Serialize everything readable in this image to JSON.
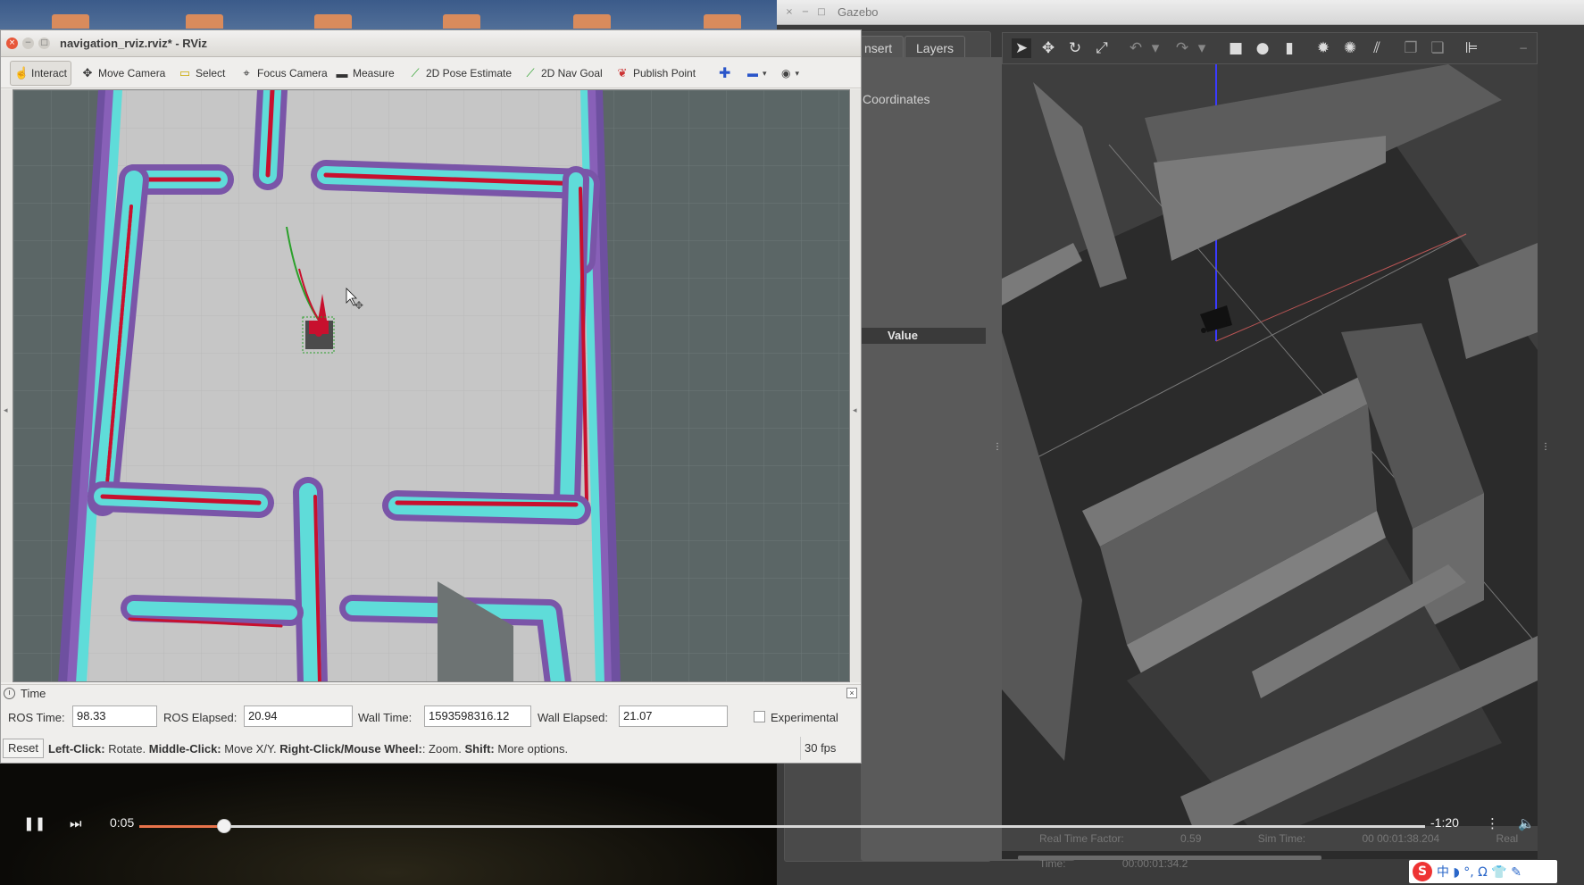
{
  "gazebo": {
    "title": "Gazebo",
    "tabs": [
      "nsert",
      "Layers"
    ],
    "coordinates_label": "Coordinates",
    "value_header": "Value",
    "status": {
      "real_time_factor_label": "Real Time Factor:",
      "real_time_factor": "0.59",
      "sim_time_label": "Sim Time:",
      "sim_time": "00 00:01:38.204",
      "real_time_label": "Real Time:",
      "real_time": "00:00:01:34.2"
    }
  },
  "rviz": {
    "title": "navigation_rviz.rviz* - RViz",
    "tools": [
      {
        "label": "Interact",
        "icon": "interact-icon",
        "active": true
      },
      {
        "label": "Move Camera",
        "icon": "move-camera-icon"
      },
      {
        "label": "Select",
        "icon": "select-icon"
      },
      {
        "label": "Focus Camera",
        "icon": "focus-camera-icon"
      },
      {
        "label": "Measure",
        "icon": "measure-icon"
      },
      {
        "label": "2D Pose Estimate",
        "icon": "pose-estimate-icon"
      },
      {
        "label": "2D Nav Goal",
        "icon": "nav-goal-icon"
      },
      {
        "label": "Publish Point",
        "icon": "publish-point-icon"
      }
    ],
    "time_panel": {
      "title": "Time",
      "ros_time_label": "ROS Time:",
      "ros_time": "98.33",
      "ros_elapsed_label": "ROS Elapsed:",
      "ros_elapsed": "20.94",
      "wall_time_label": "Wall Time:",
      "wall_time": "1593598316.12",
      "wall_elapsed_label": "Wall Elapsed:",
      "wall_elapsed": "21.07",
      "experimental_label": "Experimental"
    },
    "status": {
      "reset_label": "Reset",
      "help_left_click": "Left-Click:",
      "help_left_click_text": "Rotate.",
      "help_middle_click": "Middle-Click:",
      "help_middle_click_text": "Move X/Y.",
      "help_right_click": "Right-Click/Mouse Wheel:",
      "help_right_click_text": ": Zoom.",
      "help_shift": "Shift:",
      "help_shift_text": "More options.",
      "fps": "30 fps"
    }
  },
  "player": {
    "elapsed": "0:05",
    "remaining": "-1:20",
    "progress_fraction": 0.066
  },
  "ime": {
    "logo": "S",
    "items": "中 ◗ °, Ω 👕 ✎"
  },
  "colors": {
    "costmap_cyan": "#5fdcd9",
    "costmap_purple": "#7a55a8",
    "costmap_violet": "#9a6fc9",
    "obstacle_red": "#c8102e",
    "floor_gray": "#c6c6c6",
    "player_progress": "#e8734b"
  }
}
